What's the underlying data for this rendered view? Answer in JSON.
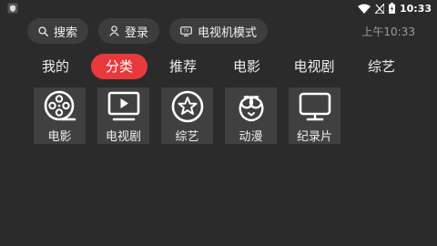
{
  "status_bar": {
    "time": "10:33",
    "icons": [
      "app-shield-icon",
      "wifi-icon",
      "signal-off-icon",
      "battery-charging-icon"
    ]
  },
  "top_bar": {
    "search_label": "搜索",
    "login_label": "登录",
    "tv_mode_label": "电视机模式",
    "clock": "上午10:33"
  },
  "tabs": [
    {
      "label": "我的",
      "active": false
    },
    {
      "label": "分类",
      "active": true
    },
    {
      "label": "推荐",
      "active": false
    },
    {
      "label": "电影",
      "active": false
    },
    {
      "label": "电视剧",
      "active": false
    },
    {
      "label": "综艺",
      "active": false
    }
  ],
  "categories": [
    {
      "label": "电影",
      "icon": "film-reel-icon"
    },
    {
      "label": "电视剧",
      "icon": "tv-play-icon"
    },
    {
      "label": "综艺",
      "icon": "star-circle-icon"
    },
    {
      "label": "动漫",
      "icon": "bear-face-icon"
    },
    {
      "label": "纪录片",
      "icon": "monitor-icon"
    }
  ],
  "colors": {
    "background": "#2b2b2b",
    "pill": "#3d3d3d",
    "tile": "#404040",
    "accent": "#e8393c"
  }
}
